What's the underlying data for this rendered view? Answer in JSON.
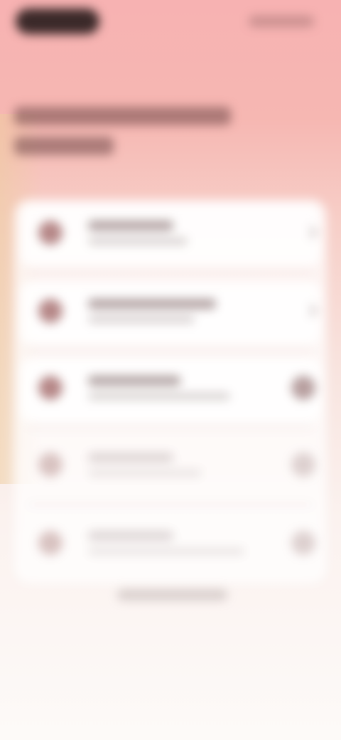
{
  "header": {
    "icons": [
      "back-icon",
      "more-options-icon"
    ]
  },
  "settings_list": {
    "rows": [
      {
        "icon": "settings-icon",
        "action": "chevron",
        "active": true
      },
      {
        "icon": "settings-icon",
        "action": "chevron",
        "active": true
      },
      {
        "icon": "settings-icon",
        "action": "toggle",
        "active": true
      },
      {
        "icon": "settings-icon",
        "action": "toggle",
        "active": false
      },
      {
        "icon": "settings-icon",
        "action": "toggle",
        "active": false
      }
    ]
  },
  "colors": {
    "headline": "#6b4848",
    "icon_active": "#b68888",
    "icon_faded": "#d8c2c0",
    "toggle_active": "#b8a0a0",
    "toggle_faded": "#ddd0cf"
  }
}
